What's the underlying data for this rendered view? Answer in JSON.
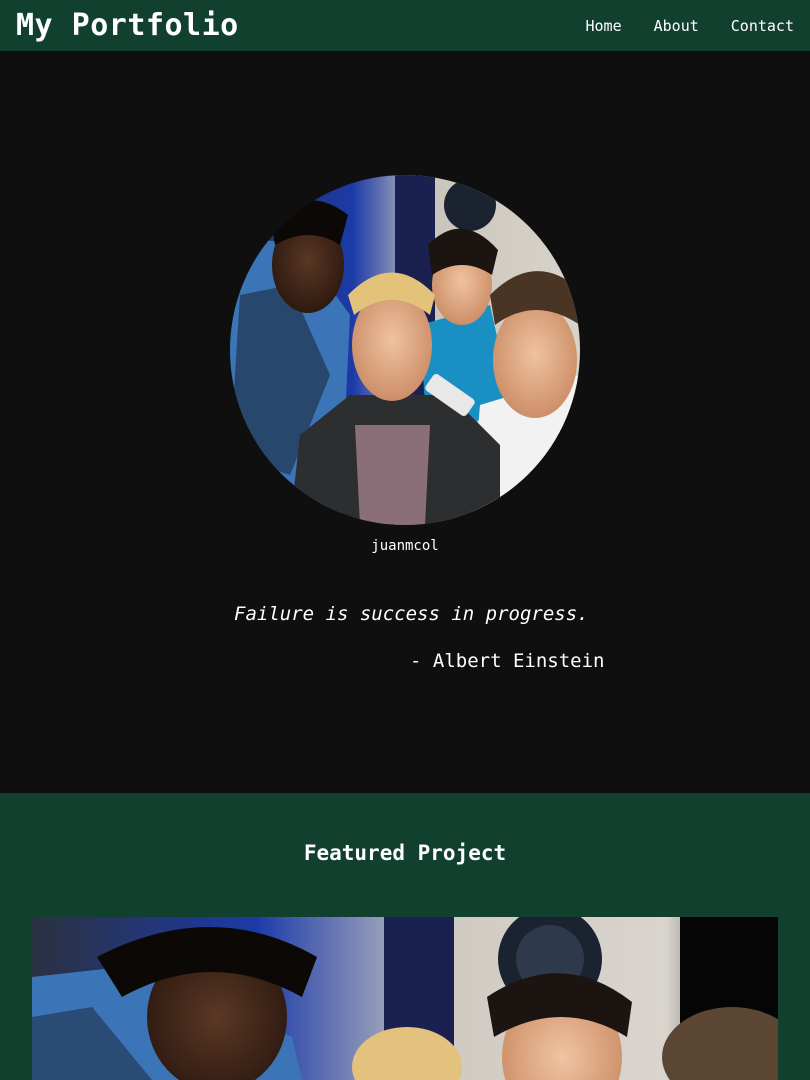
{
  "header": {
    "brand": "My Portfolio",
    "nav": [
      {
        "label": "Home"
      },
      {
        "label": "About"
      },
      {
        "label": "Contact"
      }
    ]
  },
  "profile": {
    "username": "juanmcol",
    "avatar_alt": "Profile photo of four people leaning toward the camera"
  },
  "quote": {
    "text": "Failure is success in progress.",
    "author": "- Albert Einstein"
  },
  "featured": {
    "title": "Featured Project",
    "image_alt": "Featured project image"
  }
}
